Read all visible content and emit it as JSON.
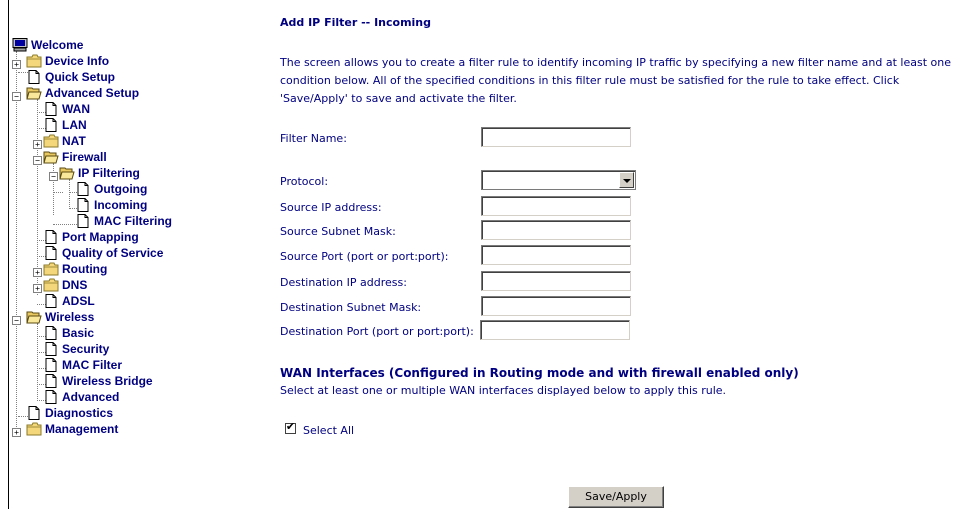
{
  "tree": {
    "welcome": "Welcome",
    "device_info": "Device Info",
    "quick_setup": "Quick Setup",
    "advanced_setup": "Advanced Setup",
    "wan": "WAN",
    "lan": "LAN",
    "nat": "NAT",
    "firewall": "Firewall",
    "ip_filtering": "IP Filtering",
    "outgoing": "Outgoing",
    "incoming": "Incoming",
    "mac_filtering": "MAC Filtering",
    "port_mapping": "Port Mapping",
    "qos": "Quality of Service",
    "routing": "Routing",
    "dns": "DNS",
    "adsl": "ADSL",
    "wireless": "Wireless",
    "basic": "Basic",
    "security": "Security",
    "mac_filter": "MAC Filter",
    "wireless_bridge": "Wireless Bridge",
    "advanced": "Advanced",
    "diagnostics": "Diagnostics",
    "management": "Management"
  },
  "main": {
    "title": "Add IP Filter -- Incoming",
    "description": "The screen allows you to create a filter rule to identify incoming IP traffic by specifying a new filter name and at least one condition below. All of the specified conditions in this filter rule must be satisfied for the rule to take effect. Click 'Save/Apply' to save and activate the filter.",
    "fields": {
      "filter_name": {
        "label": "Filter Name:",
        "value": ""
      },
      "protocol": {
        "label": "Protocol:",
        "value": ""
      },
      "src_ip": {
        "label": "Source IP address:",
        "value": ""
      },
      "src_mask": {
        "label": "Source Subnet Mask:",
        "value": ""
      },
      "src_port": {
        "label": "Source Port (port or port:port):",
        "value": ""
      },
      "dst_ip": {
        "label": "Destination IP address:",
        "value": ""
      },
      "dst_mask": {
        "label": "Destination Subnet Mask:",
        "value": ""
      },
      "dst_port": {
        "label": "Destination Port (port or port:port):",
        "value": ""
      }
    },
    "wan_title": "WAN Interfaces (Configured in Routing mode and with firewall enabled only)",
    "wan_subtitle": "Select at least one or multiple WAN interfaces displayed below to apply this rule.",
    "select_all_label": "Select All",
    "select_all_checked": true,
    "save_button": "Save/Apply"
  },
  "colors": {
    "text": "#000080",
    "folder": "#f5d77b",
    "button_face": "#d4d0c8"
  }
}
